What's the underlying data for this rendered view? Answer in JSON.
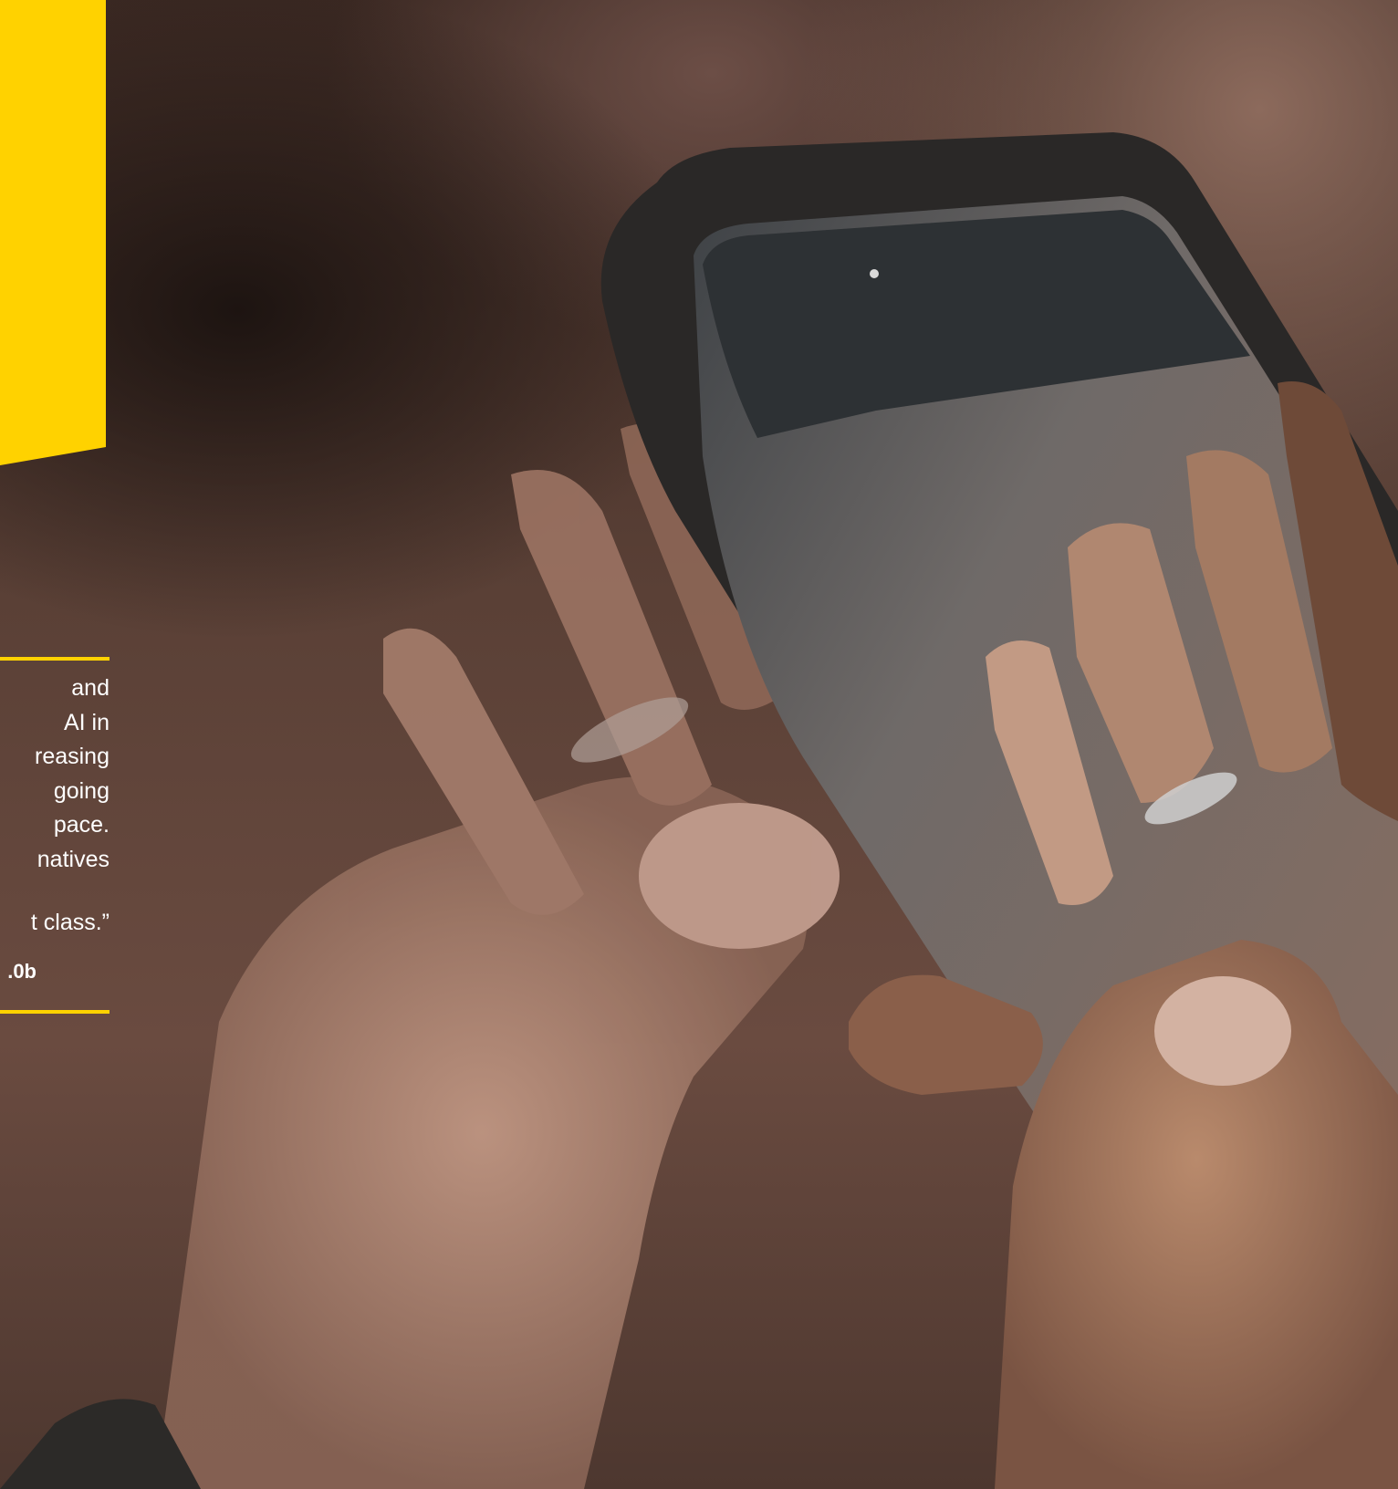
{
  "colors": {
    "accent": "#ffd200",
    "text": "#ffffff",
    "phone_case": "#2a2827"
  },
  "callout": {
    "lines": "and\nAI in\nreasing\n going\npace.\nnatives",
    "quote_end": "t class.”",
    "figure": ".0b"
  },
  "photo": {
    "subject": "hands holding a smartphone in a dark case, ring visible"
  }
}
